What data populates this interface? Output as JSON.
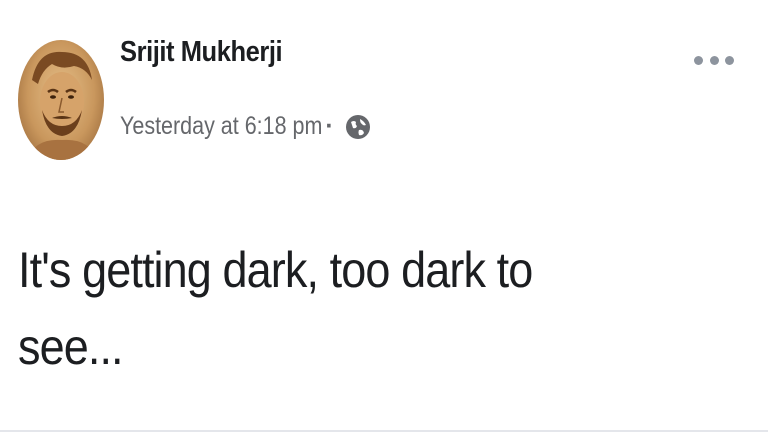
{
  "post": {
    "author_name": "Srijit Mukherji",
    "timestamp": "Yesterday at 6:18 pm",
    "separator": "·",
    "privacy_icon": "globe-icon",
    "more_icon": "more-options-icon",
    "text": "It's getting dark, too dark to see..."
  },
  "colors": {
    "name": "#1c1e21",
    "meta": "#65676b",
    "icon": "#8d949e",
    "background": "#ffffff"
  }
}
